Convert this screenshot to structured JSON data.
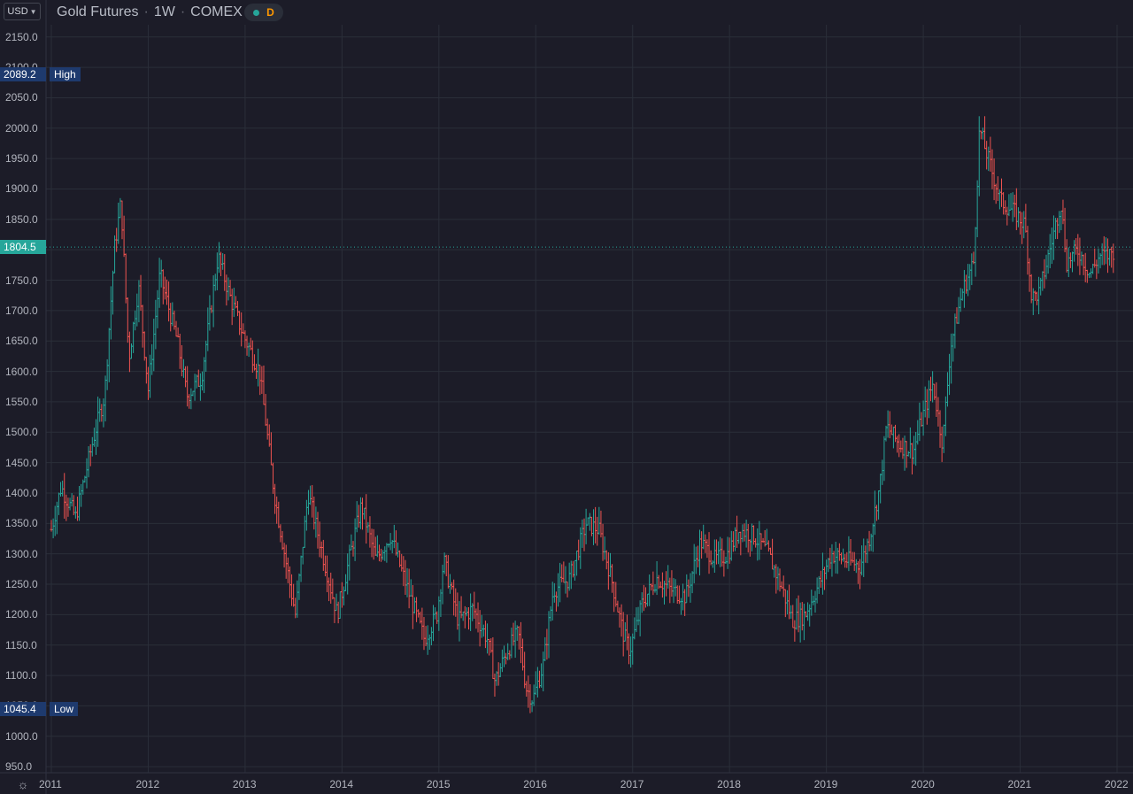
{
  "header": {
    "currency": "USD",
    "symbol": "Gold Futures",
    "interval": "1W",
    "exchange": "COMEX",
    "status_letter": "D"
  },
  "markers": {
    "high": {
      "value": "2089.2",
      "label": "High"
    },
    "low": {
      "value": "1045.4",
      "label": "Low"
    },
    "last": {
      "value": "1804.5"
    }
  },
  "colors": {
    "background": "#1c1c28",
    "grid": "#2a2e39",
    "up": "#26a69a",
    "down": "#ef5350",
    "high_low_tag": "#1e3a6e",
    "last_price": "#26a69a"
  },
  "chart_data": {
    "type": "ohlc",
    "x_unit": "year",
    "y_ticks": [
      950.0,
      1000.0,
      1050.0,
      1100.0,
      1150.0,
      1200.0,
      1250.0,
      1300.0,
      1350.0,
      1400.0,
      1450.0,
      1500.0,
      1550.0,
      1600.0,
      1650.0,
      1700.0,
      1750.0,
      1800.0,
      1850.0,
      1900.0,
      1950.0,
      2000.0,
      2050.0,
      2100.0,
      2150.0
    ],
    "ylim": [
      940,
      2170
    ],
    "x_ticks": [
      "2011",
      "2012",
      "2013",
      "2014",
      "2015",
      "2016",
      "2017",
      "2018",
      "2019",
      "2020",
      "2021",
      "2022"
    ],
    "xlim": [
      2011.0,
      2022.0
    ],
    "grid": true,
    "price_path": [
      [
        2011.0,
        1340
      ],
      [
        2011.1,
        1410
      ],
      [
        2011.25,
        1360
      ],
      [
        2011.45,
        1500
      ],
      [
        2011.55,
        1560
      ],
      [
        2011.65,
        1800
      ],
      [
        2011.72,
        1880
      ],
      [
        2011.8,
        1620
      ],
      [
        2011.9,
        1740
      ],
      [
        2012.0,
        1570
      ],
      [
        2012.12,
        1760
      ],
      [
        2012.3,
        1650
      ],
      [
        2012.4,
        1560
      ],
      [
        2012.55,
        1590
      ],
      [
        2012.72,
        1790
      ],
      [
        2012.85,
        1720
      ],
      [
        2012.98,
        1660
      ],
      [
        2013.15,
        1600
      ],
      [
        2013.3,
        1400
      ],
      [
        2013.45,
        1260
      ],
      [
        2013.52,
        1200
      ],
      [
        2013.65,
        1400
      ],
      [
        2013.8,
        1300
      ],
      [
        2013.95,
        1200
      ],
      [
        2014.1,
        1310
      ],
      [
        2014.2,
        1380
      ],
      [
        2014.35,
        1290
      ],
      [
        2014.5,
        1330
      ],
      [
        2014.7,
        1230
      ],
      [
        2014.85,
        1160
      ],
      [
        2014.98,
        1200
      ],
      [
        2015.05,
        1290
      ],
      [
        2015.2,
        1190
      ],
      [
        2015.35,
        1210
      ],
      [
        2015.5,
        1160
      ],
      [
        2015.58,
        1090
      ],
      [
        2015.7,
        1140
      ],
      [
        2015.82,
        1170
      ],
      [
        2015.9,
        1080
      ],
      [
        2015.97,
        1060
      ],
      [
        2016.08,
        1120
      ],
      [
        2016.18,
        1240
      ],
      [
        2016.35,
        1260
      ],
      [
        2016.52,
        1350
      ],
      [
        2016.65,
        1340
      ],
      [
        2016.78,
        1260
      ],
      [
        2016.9,
        1170
      ],
      [
        2016.97,
        1140
      ],
      [
        2017.1,
        1220
      ],
      [
        2017.25,
        1260
      ],
      [
        2017.4,
        1240
      ],
      [
        2017.55,
        1230
      ],
      [
        2017.7,
        1320
      ],
      [
        2017.85,
        1290
      ],
      [
        2017.98,
        1300
      ],
      [
        2018.1,
        1340
      ],
      [
        2018.25,
        1330
      ],
      [
        2018.4,
        1300
      ],
      [
        2018.55,
        1240
      ],
      [
        2018.65,
        1190
      ],
      [
        2018.78,
        1200
      ],
      [
        2018.95,
        1260
      ],
      [
        2019.05,
        1300
      ],
      [
        2019.2,
        1290
      ],
      [
        2019.35,
        1280
      ],
      [
        2019.45,
        1330
      ],
      [
        2019.55,
        1410
      ],
      [
        2019.62,
        1510
      ],
      [
        2019.75,
        1480
      ],
      [
        2019.9,
        1470
      ],
      [
        2019.98,
        1520
      ],
      [
        2020.1,
        1580
      ],
      [
        2020.2,
        1480
      ],
      [
        2020.28,
        1640
      ],
      [
        2020.4,
        1730
      ],
      [
        2020.52,
        1780
      ],
      [
        2020.58,
        2000
      ],
      [
        2020.65,
        1960
      ],
      [
        2020.8,
        1880
      ],
      [
        2020.95,
        1860
      ],
      [
        2021.05,
        1840
      ],
      [
        2021.12,
        1720
      ],
      [
        2021.2,
        1730
      ],
      [
        2021.35,
        1830
      ],
      [
        2021.42,
        1880
      ],
      [
        2021.48,
        1780
      ],
      [
        2021.6,
        1800
      ],
      [
        2021.72,
        1760
      ],
      [
        2021.82,
        1790
      ],
      [
        2021.9,
        1790
      ],
      [
        2021.98,
        1800
      ]
    ]
  }
}
